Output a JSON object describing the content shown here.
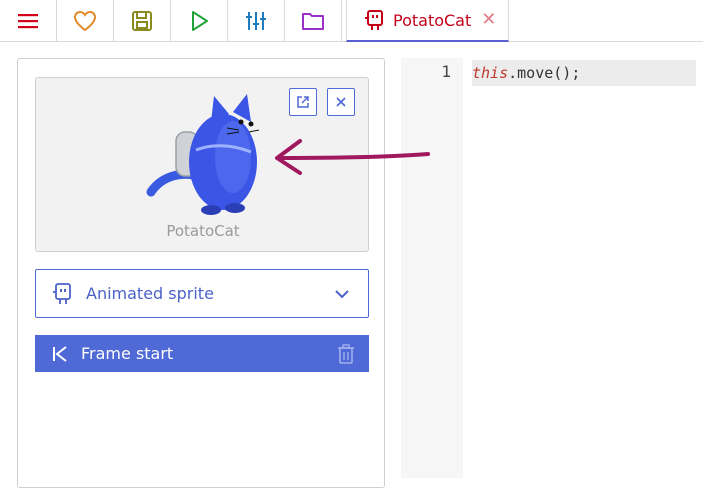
{
  "toolbar": {
    "buttons": [
      {
        "icon": "hamburger-menu-icon",
        "color": "#d0021b"
      },
      {
        "icon": "heart-icon",
        "color": "#e08a2a"
      },
      {
        "icon": "save-icon",
        "color": "#8a8a1f"
      },
      {
        "icon": "play-icon",
        "color": "#22a33a"
      },
      {
        "icon": "sliders-icon",
        "color": "#1f7ac0"
      },
      {
        "icon": "folder-icon",
        "color": "#9b2fc9"
      }
    ],
    "active_tab": {
      "icon": "robot-sprite-icon",
      "label": "PotatoCat",
      "close": "✕"
    }
  },
  "sprite_card": {
    "name": "PotatoCat",
    "open_icon": "external-link-icon",
    "close_icon": "close-icon"
  },
  "sprite_type": {
    "label": "Animated sprite",
    "icon": "robot-sprite-icon"
  },
  "event": {
    "label": "Frame start",
    "icon": "skip-back-icon",
    "delete_icon": "trash-icon"
  },
  "editor": {
    "line_number": "1",
    "code_keyword": "this",
    "code_rest": ".move();"
  },
  "colors": {
    "accent": "#4f6ad6",
    "tab_text": "#c4001a",
    "annotation": "#a0185e"
  }
}
